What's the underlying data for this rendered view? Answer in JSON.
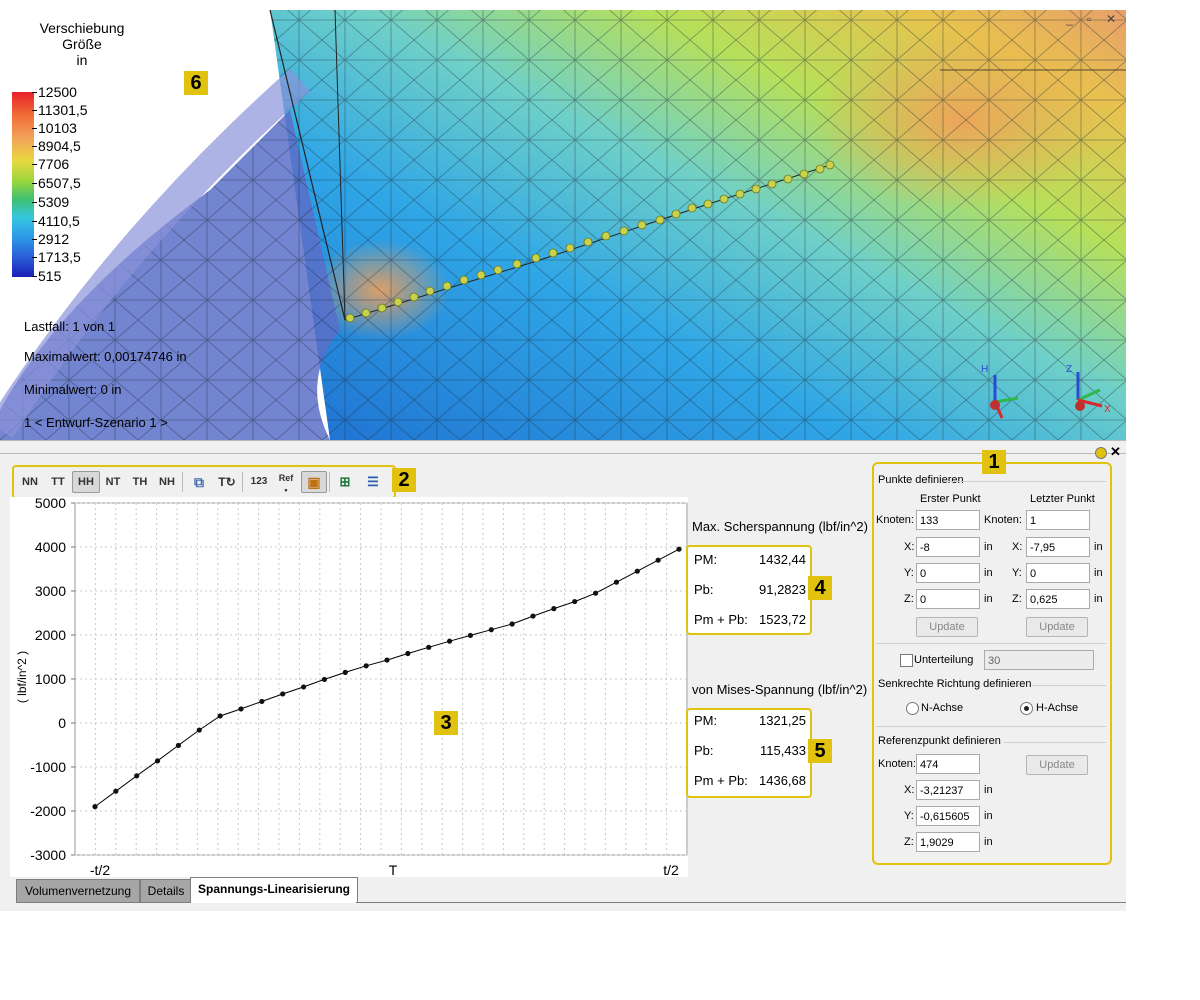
{
  "viewport": {
    "legend": {
      "title_line1": "Verschiebung",
      "title_line2": "Größe",
      "title_line3": "in",
      "ticks": [
        "12500",
        "11301,5",
        "10103",
        "8904,5",
        "7706",
        "6507,5",
        "5309",
        "4110,5",
        "2912",
        "1713,5",
        "515"
      ]
    },
    "info": {
      "load_case": "Lastfall: 1 von 1",
      "max_value": "Maximalwert: 0,00174746 in",
      "min_value": "Minimalwert: 0 in",
      "scenario": "1 < Entwurf-Szenario 1 >"
    },
    "callout_6": "6",
    "window_controls": [
      "_",
      "▫",
      "✕"
    ],
    "axis_labels": {
      "h": "H",
      "z": "Z",
      "x": "X"
    }
  },
  "panel": {
    "toolbar": {
      "buttons": [
        "NN",
        "TT",
        "HH",
        "NT",
        "TH",
        "NH"
      ],
      "active": "HH",
      "numbers_button": "123",
      "ref_button": "Ref",
      "callout": "2"
    },
    "chart_callout": "3",
    "max_shear": {
      "title": "Max. Scherspannung (lbf/in^2)",
      "pm_label": "PM:",
      "pm_value": "1432,44",
      "pb_label": "Pb:",
      "pb_value": "91,2823",
      "sum_label": "Pm + Pb:",
      "sum_value": "1523,72",
      "callout": "4"
    },
    "von_mises": {
      "title": "von Mises-Spannung (lbf/in^2)",
      "pm_label": "PM:",
      "pm_value": "1321,25",
      "pb_label": "Pb:",
      "pb_value": "115,433",
      "sum_label": "Pm + Pb:",
      "sum_value": "1436,68",
      "callout": "5"
    },
    "settings": {
      "callout": "1",
      "points_group": "Punkte definieren",
      "first_point": "Erster Punkt",
      "last_point": "Letzter Punkt",
      "node_label": "Knoten:",
      "first": {
        "node": "133",
        "x": "-8",
        "y": "0",
        "z": "0"
      },
      "last": {
        "node": "1",
        "x": "-7,95",
        "y": "0",
        "z": "0,625"
      },
      "x_label": "X:",
      "y_label": "Y:",
      "z_label": "Z:",
      "unit": "in",
      "update_label": "Update",
      "subdivision_label": "Unterteilung",
      "subdivision_value": "30",
      "normal_group": "Senkrechte Richtung definieren",
      "n_axis": "N-Achse",
      "h_axis": "H-Achse",
      "selected_axis": "H-Achse",
      "ref_group": "Referenzpunkt definieren",
      "ref": {
        "node": "474",
        "x": "-3,21237",
        "y": "-0,615605",
        "z": "1,9029"
      }
    },
    "tabs": [
      "Volumenvernetzung",
      "Details",
      "Spannungs-Linearisierung"
    ],
    "active_tab": "Spannungs-Linearisierung"
  },
  "chart_data": {
    "type": "line",
    "ylabel": "( lbf/in^2 )",
    "xlabel": "T",
    "x_tick_labels": [
      "-t/2",
      "t/2"
    ],
    "ylim": [
      -3000,
      5000
    ],
    "y_ticks": [
      5000,
      4000,
      3000,
      2000,
      1000,
      0,
      -1000,
      -2000,
      -3000
    ],
    "grid": true,
    "series": [
      {
        "values": [
          -1900,
          -1550,
          -1200,
          -860,
          -510,
          -160,
          160,
          320,
          490,
          660,
          820,
          990,
          1150,
          1300,
          1430,
          1580,
          1720,
          1860,
          1990,
          2120,
          2250,
          2430,
          2600,
          2760,
          2950,
          3200,
          3450,
          3700,
          3950
        ]
      }
    ]
  }
}
